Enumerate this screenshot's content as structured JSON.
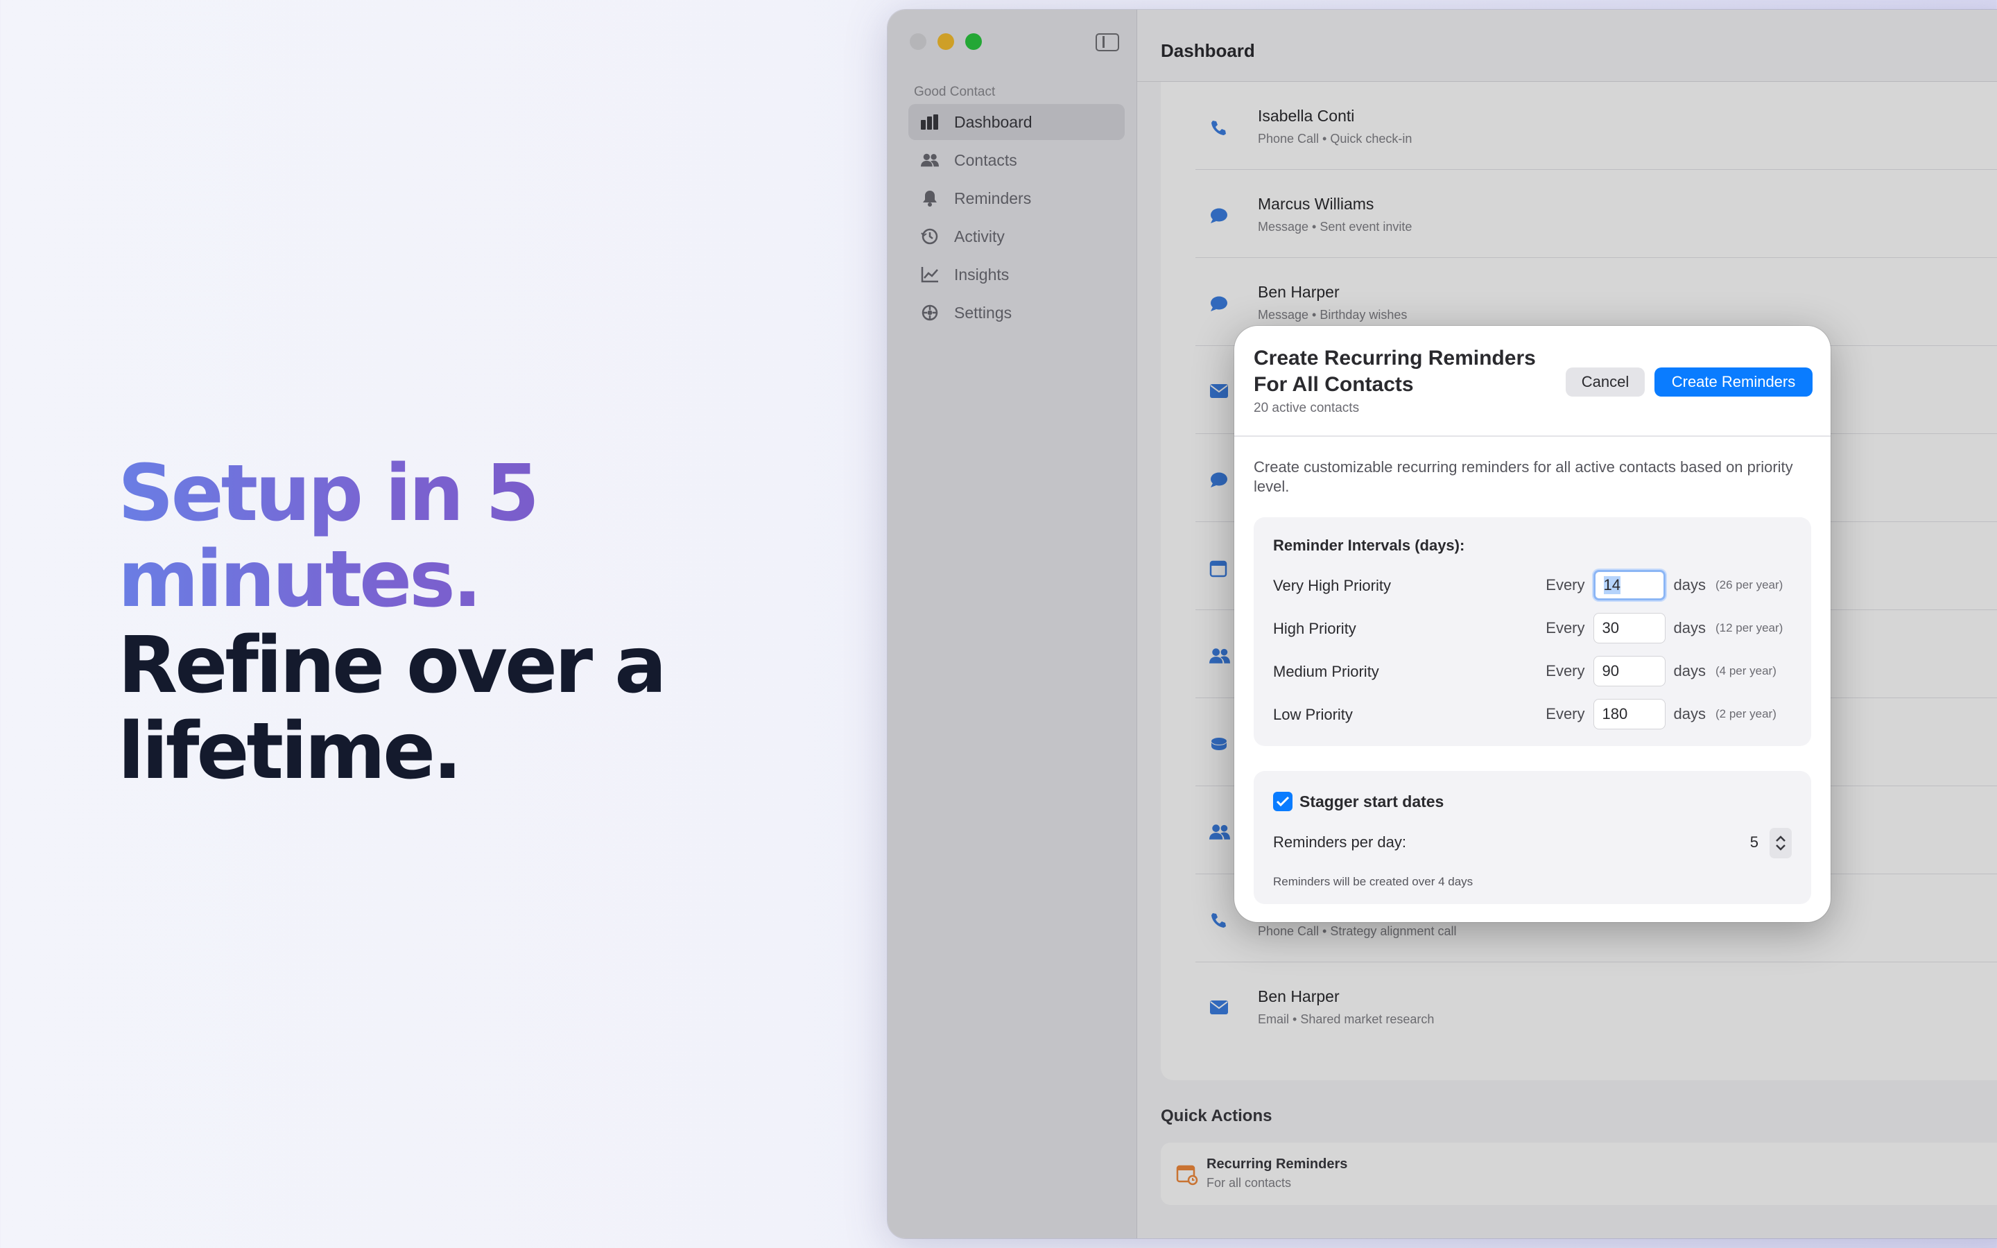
{
  "headline": {
    "line1": "Setup in 5",
    "line2": "minutes.",
    "line3": "Refine over a",
    "line4": "lifetime."
  },
  "window": {
    "title": "Dashboard",
    "sidebar": {
      "section": "Good Contact",
      "items": [
        {
          "label": "Dashboard",
          "icon": "chart-bars-icon",
          "active": true
        },
        {
          "label": "Contacts",
          "icon": "people-icon"
        },
        {
          "label": "Reminders",
          "icon": "bell-icon"
        },
        {
          "label": "Activity",
          "icon": "history-icon"
        },
        {
          "label": "Insights",
          "icon": "line-chart-icon"
        },
        {
          "label": "Settings",
          "icon": "gear-icon"
        }
      ]
    },
    "activity": [
      {
        "name": "Isabella Conti",
        "sub": "Phone Call  •  Quick check-in",
        "icon": "phone-icon"
      },
      {
        "name": "Marcus Williams",
        "sub": "Message  •  Sent event invite",
        "icon": "message-icon"
      },
      {
        "name": "Ben Harper",
        "sub": "Message  •  Birthday wishes",
        "icon": "message-icon"
      },
      {
        "name": "",
        "sub": "",
        "icon": "email-icon"
      },
      {
        "name": "",
        "sub": "",
        "icon": "message-icon"
      },
      {
        "name": "",
        "sub": "",
        "icon": "calendar-icon"
      },
      {
        "name": "",
        "sub": "",
        "icon": "people-icon"
      },
      {
        "name": "",
        "sub": "",
        "icon": "coffee-icon"
      },
      {
        "name": "",
        "sub": "",
        "icon": "people-icon"
      },
      {
        "name": "",
        "sub": "Phone Call  •  Strategy alignment call",
        "icon": "phone-icon"
      },
      {
        "name": "Ben Harper",
        "sub": "Email  •  Shared market research",
        "icon": "email-icon"
      }
    ],
    "quick_actions": {
      "title": "Quick Actions",
      "item_label": "Recurring Reminders",
      "item_sub": "For all contacts"
    }
  },
  "modal": {
    "title": "Create Recurring Reminders For All Contacts",
    "subtitle": "20 active contacts",
    "cancel_label": "Cancel",
    "create_label": "Create Reminders",
    "description": "Create customizable recurring reminders for all active contacts based on priority level.",
    "intervals_title": "Reminder Intervals (days):",
    "every_label": "Every",
    "days_label": "days",
    "priorities": [
      {
        "label": "Very High Priority",
        "value": "14",
        "per_year": "(26 per year)"
      },
      {
        "label": "High Priority",
        "value": "30",
        "per_year": "(12 per year)"
      },
      {
        "label": "Medium Priority",
        "value": "90",
        "per_year": "(4 per year)"
      },
      {
        "label": "Low Priority",
        "value": "180",
        "per_year": "(2 per year)"
      }
    ],
    "stagger_label": "Stagger start dates",
    "stagger_checked": true,
    "reminders_per_day_label": "Reminders per day:",
    "reminders_per_day_value": "5",
    "note": "Reminders will be created over 4 days"
  },
  "colors": {
    "accent": "#0a7cff",
    "gradient_start": "#6a7ee4",
    "gradient_end": "#7a55c2",
    "headline_dark": "#141a2d",
    "traffic_yellow": "#f6be2f",
    "traffic_green": "#2bc840"
  }
}
